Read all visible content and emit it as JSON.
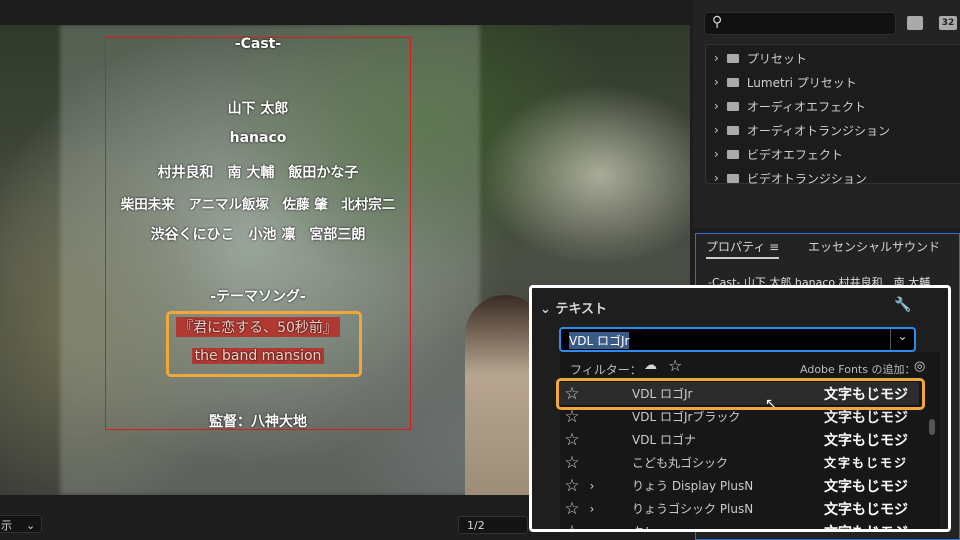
{
  "preview": {
    "credits": {
      "cast_heading": "-Cast-",
      "lines": [
        "山下 太郎",
        "hanaco",
        "村井良和　南 大輔　飯田かな子",
        "柴田未来　アニマル飯塚　佐藤 肇　北村宗二",
        "渋谷くにひこ　小池 凛　宮部三朗"
      ],
      "theme_heading": "-テーマソング-",
      "song_title": "『君に恋する、50秒前』",
      "song_artist": "the band mansion",
      "director": "監督：八神大地"
    },
    "zoom_select": "示",
    "page_select": "1/2"
  },
  "effects_panel": {
    "icons": [
      "search-icon",
      "new-bin-icon",
      "32-bit-icon"
    ],
    "items": [
      "プリセット",
      "Lumetri プリセット",
      "オーディオエフェクト",
      "オーディオトランジション",
      "ビデオエフェクト",
      "ビデオトランジション"
    ]
  },
  "properties_panel": {
    "tabs": [
      "プロパティ",
      "エッセンシャルサウンド"
    ],
    "clip_name": "-Cast- 山下 太郎 hanaco 村井良和　南 大輔"
  },
  "text_section": {
    "title": "テキスト",
    "font_value": "VDL ロゴJr",
    "filter_label": "フィルター：",
    "adobe_fonts_label": "Adobe Fonts の追加：",
    "fonts": [
      {
        "name": "VDL ロゴJr",
        "preview": "文字もじモジ",
        "expand": false
      },
      {
        "name": "VDL ロゴJrブラック",
        "preview": "文字もじモジ",
        "expand": false
      },
      {
        "name": "VDL ロゴナ",
        "preview": "文字もじモジ",
        "expand": false
      },
      {
        "name": "こども丸ゴシック",
        "preview": "文字もじモジ",
        "expand": false
      },
      {
        "name": "りょう Display PlusN",
        "preview": "文字もじモジ",
        "expand": true
      },
      {
        "name": "りょうゴシック PlusN",
        "preview": "文字もじモジ",
        "expand": true
      },
      {
        "name": "タレ",
        "preview": "文字もじモジ",
        "expand": true
      }
    ]
  },
  "colors": {
    "highlight": "#f0a83a",
    "accent": "#2d6fd6",
    "title_safe": "#e01818"
  }
}
